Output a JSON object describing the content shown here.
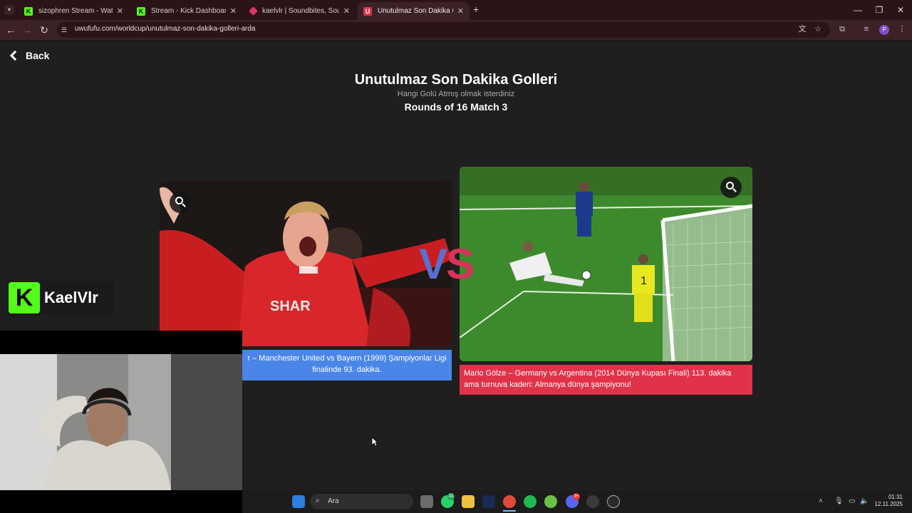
{
  "browser": {
    "tabs": [
      {
        "title": "sizophren Stream - Watch Live",
        "favicon_color": "#53fc18",
        "favicon_letter": "K",
        "active": false
      },
      {
        "title": "Stream - Kick Dashboard",
        "favicon_color": "#53fc18",
        "favicon_letter": "K",
        "active": false
      },
      {
        "title": "kaelvlr | Soundbites, Sounds M",
        "favicon_color": "#e0336a",
        "favicon_letter": "",
        "active": false
      },
      {
        "title": "Unutulmaz Son Dakika Golleri |",
        "favicon_color": "#e0334a",
        "favicon_letter": "U",
        "active": true
      }
    ],
    "new_tab_label": "+",
    "url": "uwufufu.com/worldcup/unutulmaz-son-dakika-golleri-arda"
  },
  "page": {
    "back_label": "Back",
    "title": "Unutulmaz Son Dakika Golleri",
    "subtitle": "Hangi Golü Atmış olmak isterdiniz",
    "round": "Rounds of 16 Match 3",
    "vs_v": "V",
    "vs_s": "S",
    "left_option": {
      "caption": "r – Manchester United vs Bayern (1999) Şampiyonlar Ligi finalinde 93. dakika.",
      "shirt_text": "SHAR",
      "color": "#4a86e8"
    },
    "right_option": {
      "caption": "Mario Gölze – Germany vs Argentina (2014 Dünya Kupası Finali) 113. dakika ama turnuva kaderi: Almanya dünya şampiyonu!",
      "color": "#e0334a"
    }
  },
  "overlay": {
    "kick_logo_letter": "K",
    "streamer_name": "KaelVlr"
  },
  "taskbar": {
    "search_placeholder": "Ara",
    "whatsapp_badge": "31",
    "discord_badge": "9+",
    "time": "01:31",
    "date": "12.11.2025"
  }
}
